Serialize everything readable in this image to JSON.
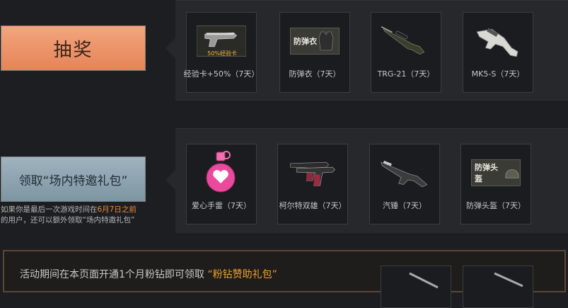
{
  "lottery": {
    "button_label": "抽奖",
    "items": [
      {
        "label": "经验卡+50%（7天）",
        "badge": "50%经验卡",
        "icon": "pistol-exp-card-icon"
      },
      {
        "label": "防弹衣（7天）",
        "badge": "防弹衣",
        "icon": "body-armor-icon"
      },
      {
        "label": "TRG-21（7天）",
        "icon": "sniper-rifle-icon"
      },
      {
        "label": "MK5-S（7天）",
        "icon": "smg-icon"
      }
    ]
  },
  "invite": {
    "button_label": "领取“场内特邀礼包”",
    "note_prefix": "如果你是最后一次游戏时间在",
    "note_highlight": "6月7日之前",
    "note_suffix": "的用户，还可以额外领取“场内特邀礼包”",
    "items": [
      {
        "label": "爱心手雷（7天）",
        "icon": "heart-grenade-icon"
      },
      {
        "label": "柯尔特双雄（7天）",
        "icon": "dual-pistols-icon"
      },
      {
        "label": "汽锤（7天）",
        "icon": "shotgun-icon"
      },
      {
        "label": "防弹头盔（7天）",
        "badge": "防弹头盔",
        "icon": "helmet-icon"
      }
    ]
  },
  "promo": {
    "text": "活动期间在本页面开通1个月粉钻即可领取",
    "highlight": "“粉钻赞助礼包”"
  },
  "colors": {
    "lottery_button": "#ec9468",
    "invite_button": "#8ea4b0",
    "highlight_orange": "#f08a3c",
    "promo_gold": "#f0a02c"
  }
}
